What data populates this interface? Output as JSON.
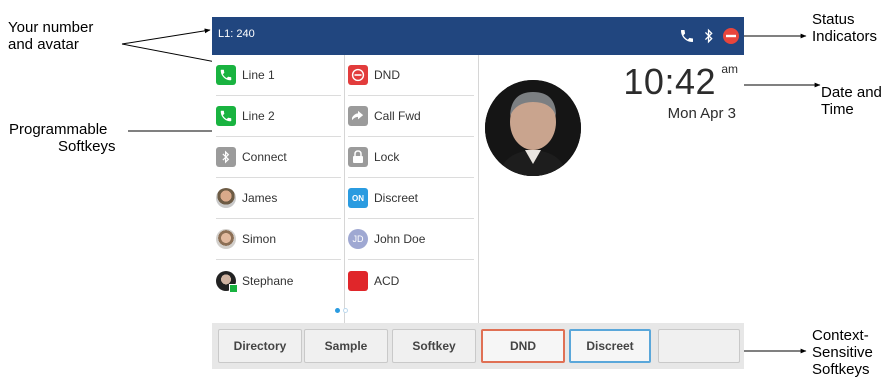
{
  "annotations": {
    "your_number_line1": "Your number",
    "your_number_line2": "and avatar",
    "programmable_line1": "Programmable",
    "programmable_line2": "Softkeys",
    "status_line1": "Status",
    "status_line2": "Indicators",
    "datetime_line1": "Date and",
    "datetime_line2": "Time",
    "context_line1": "Context-",
    "context_line2": "Sensitive",
    "context_line3": "Softkeys"
  },
  "phone": {
    "line_label": "L1: 240",
    "status_icons": [
      "phone-icon",
      "bluetooth-icon",
      "dnd-status-icon"
    ],
    "colors": {
      "topbar": "#21467f",
      "green": "#19b340",
      "red": "#e23c3c",
      "gray": "#9b9b9b",
      "blue": "#2a9be0",
      "lavender": "#9fa8d2",
      "acd_red": "#e0262a"
    },
    "programmable_keys_left": [
      {
        "label": "Line 1",
        "icon": "phone-icon"
      },
      {
        "label": "Line 2",
        "icon": "phone-icon"
      },
      {
        "label": "Connect",
        "icon": "bluetooth-icon"
      },
      {
        "label": "James",
        "icon": "contact-avatar-icon"
      },
      {
        "label": "Simon",
        "icon": "contact-avatar-icon"
      },
      {
        "label": "Stephane",
        "icon": "contact-avatar-icon"
      }
    ],
    "programmable_keys_right": [
      {
        "label": "DND",
        "icon": "dnd-icon"
      },
      {
        "label": "Call Fwd",
        "icon": "call-forward-icon"
      },
      {
        "label": "Lock",
        "icon": "lock-icon"
      },
      {
        "label": "Discreet",
        "icon": "discreet-on-icon",
        "icon_text": "ON"
      },
      {
        "label": "John Doe",
        "icon": "initials-avatar-icon",
        "icon_text": "JD"
      },
      {
        "label": "ACD",
        "icon": "acd-icon"
      }
    ],
    "page_indicator": {
      "pages": 2,
      "current": 1
    },
    "clock": {
      "time": "10:42",
      "ampm": "am",
      "date": "Mon Apr 3"
    },
    "context_softkeys": [
      "Directory",
      "Sample",
      "Softkey",
      "DND",
      "Discreet",
      ""
    ]
  }
}
